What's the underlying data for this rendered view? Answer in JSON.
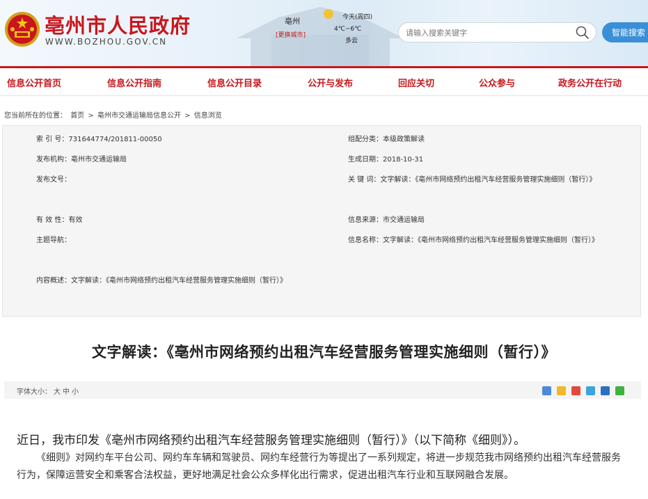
{
  "header": {
    "site_title": "亳州市人民政府",
    "site_url": "WWW.BOZHOU.GOV.CN",
    "city": "亳州",
    "city_switch": "[更换城市]",
    "weather": {
      "day": "今天(周四)",
      "temp": "4℃~6℃",
      "condition": "多云",
      "icon": "sun-cloud-icon"
    },
    "search": {
      "placeholder": "请输入搜索关键字",
      "value": ""
    },
    "smart_search_label": "智能搜索",
    "colors": {
      "brand_red": "#c8161d",
      "accent_blue": "#3b8fd6"
    }
  },
  "nav": {
    "items": [
      "信息公开首页",
      "信息公开指南",
      "信息公开目录",
      "公开与发布",
      "回应关切",
      "公众参与",
      "政务公开在行动"
    ]
  },
  "breadcrumb": {
    "prefix": "您当前所在的位置：",
    "items": [
      "首页",
      "亳州市交通运输局信息公开",
      "信息浏览"
    ],
    "separator": ">"
  },
  "info": {
    "index_label": "索 引 号：",
    "index_value": "731644774/201811-00050",
    "category_label": "组配分类：",
    "category_value": "本级政策解读",
    "publisher_label": "发布机构：",
    "publisher_value": "亳州市交通运输局",
    "date_label": "生成日期：",
    "date_value": "2018-10-31",
    "doc_no_label": "发布文号：",
    "doc_no_value": "",
    "keywords_label": "关 键 词：",
    "keywords_value": "文字解读：《亳州市网络预约出租汽车经营服务管理实施细则（暂行）》",
    "validity_label": "有 效 性：",
    "validity_value": "有效",
    "source_label": "信息来源：",
    "source_value": "市交通运输局",
    "topic_label": "主题导航：",
    "topic_value": "",
    "name_label": "信息名称：",
    "name_value": "文字解读：《亳州市网络预约出租汽车经营服务管理实施细则（暂行）》",
    "summary_label": "内容概述：",
    "summary_value": "文字解读：《亳州市网络预约出租汽车经营服务管理实施细则（暂行）》"
  },
  "article": {
    "title": "文字解读：《亳州市网络预约出租汽车经营服务管理实施细则（暂行）》",
    "font_size_label": "字体大小：",
    "font_large": "大",
    "font_medium": "中",
    "font_small": "小",
    "share_icons": [
      "plus-share-icon",
      "qzone-icon",
      "weibo-icon",
      "tencent-weibo-icon",
      "renren-icon",
      "wechat-icon"
    ],
    "lead": "近日，我市印发《亳州市网络预约出租汽车经营服务管理实施细则（暂行）》（以下简称《细则》）。",
    "body": "《细则》对网约车平台公司、网约车车辆和驾驶员、网约车经营行为等提出了一系列规定，将进一步规范我市网络预约出租汽车经营服务行为，保障运营安全和乘客合法权益，更好地满足社会公众多样化出行需求，促进出租汽车行业和互联网融合发展。"
  }
}
